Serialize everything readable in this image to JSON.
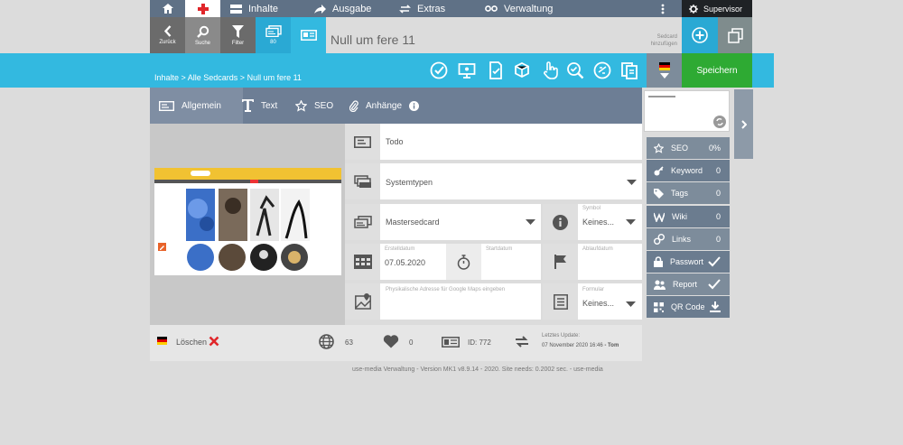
{
  "nav": {
    "items": [
      "Inhalte",
      "Ausgabe",
      "Extras",
      "Verwaltung"
    ],
    "supervisor": "Supervisor"
  },
  "toolbar": {
    "back": "Zurück",
    "search": "Suche",
    "filter": "Filter",
    "count": "80",
    "title": "Null um fere 11",
    "add_note": "Sedcard hinzufügen"
  },
  "breadcrumb": "Inhalte > Alle Sedcards > Null um fere 11",
  "save": "Speichern",
  "tabs": [
    "Allgemein",
    "Text",
    "SEO",
    "Anhänge"
  ],
  "form": {
    "todo": "Todo",
    "systemtypen": "Systemtypen",
    "mastersedcard": "Mastersedcard",
    "symbol_label": "Symbol",
    "symbol_value": "Keines...",
    "erstell_label": "Erstelldatum",
    "erstell_value": "07.05.2020",
    "start_label": "Startdatum",
    "ablauf_label": "Ablaufdatum",
    "address_placeholder": "Physikalische Adresse für Google Maps eingeben",
    "formular_label": "Formular",
    "formular_value": "Keines..."
  },
  "footer": {
    "delete": "Löschen",
    "views": "63",
    "likes": "0",
    "id": "ID: 772",
    "last_update_label": "Letztes Update:",
    "last_update_value": "07 November 2020 16:46",
    "last_update_user": "- Tom"
  },
  "version": "use-media Verwaltung - Version MK1 v8.9.14 - 2020. Site needs: 0.2002 sec. - use-media",
  "sidebar": [
    {
      "label": "SEO",
      "value": "0%",
      "icon": "star-icon"
    },
    {
      "label": "Keyword",
      "value": "0",
      "icon": "key-icon"
    },
    {
      "label": "Tags",
      "value": "0",
      "icon": "tag-icon"
    },
    {
      "label": "Wiki",
      "value": "0",
      "icon": "wiki-icon"
    },
    {
      "label": "Links",
      "value": "0",
      "icon": "link-icon"
    },
    {
      "label": "Passwort",
      "value": "",
      "icon": "lock-icon"
    },
    {
      "label": "Report",
      "value": "",
      "icon": "users-icon"
    },
    {
      "label": "QR Code",
      "value": "",
      "icon": "qr-icon"
    }
  ],
  "colors": {
    "cyan": "#33b9e0",
    "nav": "#5f7186",
    "save": "#2eaa33",
    "tabs": "#6d7e95",
    "sidebar": "#7d8c9b"
  }
}
